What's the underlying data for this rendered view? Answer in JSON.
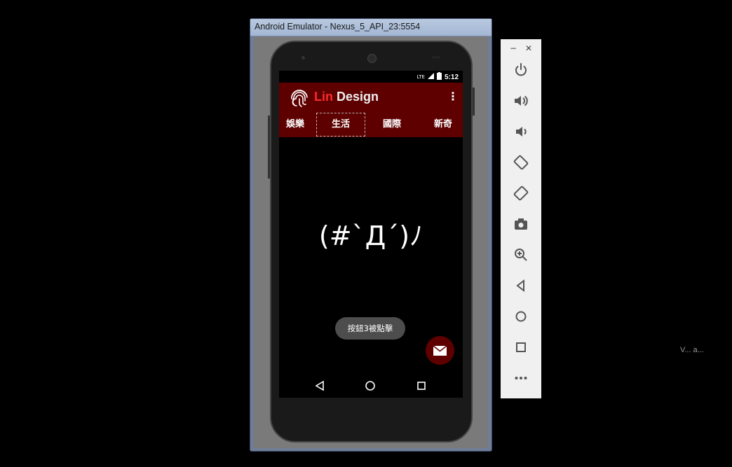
{
  "window": {
    "title": "Android Emulator - Nexus_5_API_23:5554"
  },
  "statusbar": {
    "time": "5:12",
    "network_label": "LTE"
  },
  "app": {
    "title_part1": "Lin",
    "title_part2": " Design"
  },
  "tabs": [
    {
      "label": "娛樂"
    },
    {
      "label": "生活",
      "active": true
    },
    {
      "label": "國際"
    },
    {
      "label": "新奇"
    }
  ],
  "content": {
    "emoticon": "(#`Д´)ﾉ"
  },
  "toast": {
    "text": "按鈕3被點擊"
  },
  "colors": {
    "primary": "#5e0000",
    "accent": "#ff2a2a",
    "toolbar_bg": "#f0f0f0",
    "window_frame": "#a3b6d3"
  },
  "toolbar": {
    "minimize_glyph": "−",
    "close_glyph": "✕",
    "buttons": [
      "power-icon",
      "volume-up-icon",
      "volume-down-icon",
      "rotate-left-icon",
      "rotate-right-icon",
      "camera-icon",
      "zoom-icon",
      "back-icon",
      "home-icon",
      "overview-icon",
      "more-icon"
    ]
  },
  "background_text": "V... a..."
}
